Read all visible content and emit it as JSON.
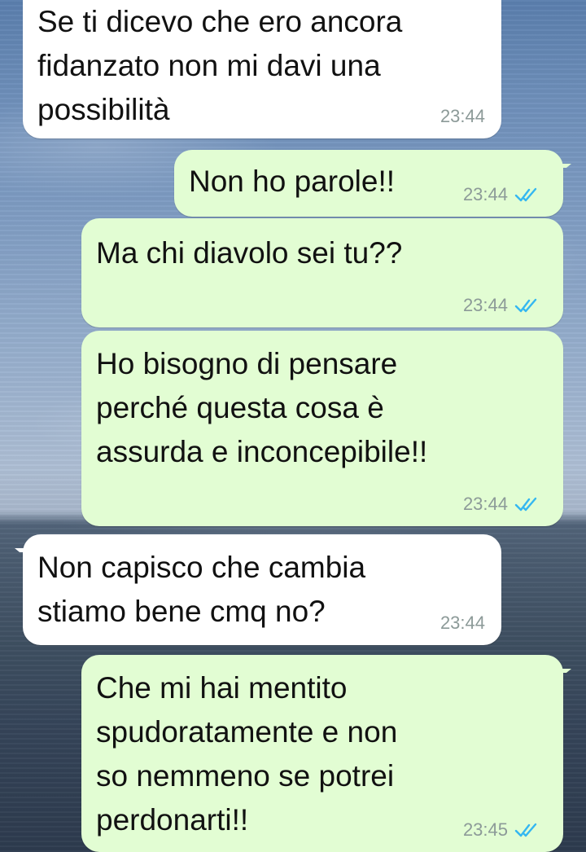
{
  "chat": {
    "messages": [
      {
        "direction": "incoming",
        "text": "Se ti dicevo che ero ancora\nfidanzato non mi davi una\npossibilità",
        "time": "23:44"
      },
      {
        "direction": "outgoing",
        "text": "Non ho parole!!",
        "time": "23:44",
        "status": "read"
      },
      {
        "direction": "outgoing",
        "text": "Ma chi diavolo sei tu??",
        "time": "23:44",
        "status": "read"
      },
      {
        "direction": "outgoing",
        "text": "Ho bisogno di pensare\nperché questa cosa è\nassurda e inconcepibile!!",
        "time": "23:44",
        "status": "read"
      },
      {
        "direction": "incoming",
        "text": "Non capisco che cambia\nstiamo bene cmq no?",
        "time": "23:44"
      },
      {
        "direction": "outgoing",
        "text": "Che mi hai mentito\nspudoratamente e non\nso nemmeno se potrei\nperdonarti!!",
        "time": "23:45",
        "status": "read"
      }
    ]
  },
  "colors": {
    "incoming_bubble": "#ffffff",
    "outgoing_bubble": "#e2fdd3",
    "timestamp": "#8c9a98",
    "read_ticks": "#34b7f1"
  },
  "icons": {
    "read_receipt": "double-check-icon"
  }
}
